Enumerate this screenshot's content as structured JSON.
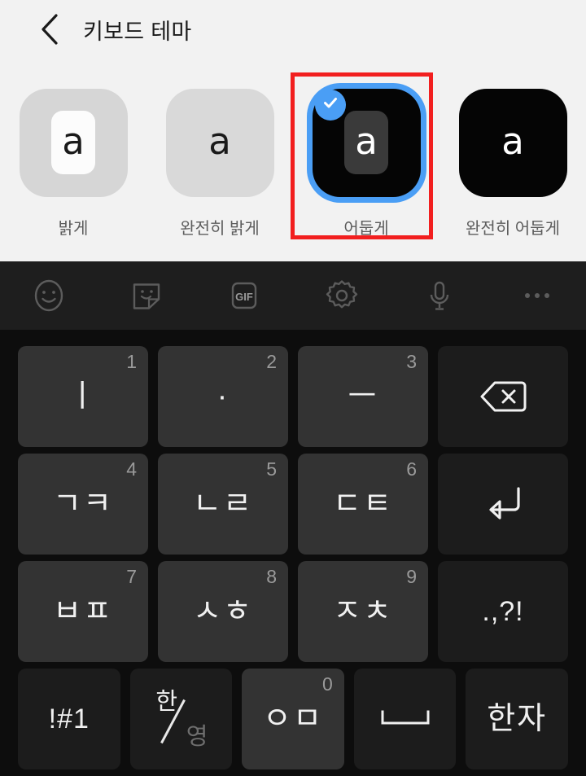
{
  "header": {
    "back_icon": "chevron-left-icon",
    "title": "키보드 테마"
  },
  "themes": {
    "selected_index": 2,
    "items": [
      {
        "label": "밝게",
        "tile_bg": "#d6d6d6",
        "key_bg": "#fcfcfc",
        "glyph": "a",
        "glyph_color": "#1a1a1a",
        "has_inner_key": true,
        "selected": false
      },
      {
        "label": "완전히 밝게",
        "tile_bg": "#d9d9d9",
        "key_bg": "#d9d9d9",
        "glyph": "a",
        "glyph_color": "#1a1a1a",
        "has_inner_key": false,
        "selected": false
      },
      {
        "label": "어둡게",
        "tile_bg": "#050505",
        "key_bg": "#3a3a3a",
        "glyph": "a",
        "glyph_color": "#ffffff",
        "has_inner_key": true,
        "selected": true
      },
      {
        "label": "완전히 어둡게",
        "tile_bg": "#050505",
        "key_bg": "#050505",
        "glyph": "a",
        "glyph_color": "#ffffff",
        "has_inner_key": false,
        "selected": false
      }
    ],
    "selected_ring_color": "#4a9ef5",
    "check_badge_color": "#4a9ef5"
  },
  "annotation": {
    "color": "#f21f1f",
    "target": "어둡게"
  },
  "keyboard": {
    "toolbar": [
      {
        "name": "emoji-icon",
        "label": ""
      },
      {
        "name": "sticker-icon",
        "label": ""
      },
      {
        "name": "gif-icon",
        "label": "GIF"
      },
      {
        "name": "settings-gear-icon",
        "label": ""
      },
      {
        "name": "microphone-icon",
        "label": ""
      },
      {
        "name": "more-options-icon",
        "label": ""
      }
    ],
    "rows": [
      [
        {
          "label": "ㅣ",
          "num": "1",
          "type": "char",
          "icon": ""
        },
        {
          "label": "·",
          "num": "2",
          "type": "char",
          "icon": ""
        },
        {
          "label": "ㅡ",
          "num": "3",
          "type": "char",
          "icon": ""
        },
        {
          "label": "",
          "num": "",
          "type": "func",
          "icon": "backspace-icon"
        }
      ],
      [
        {
          "label": "ㄱㅋ",
          "num": "4",
          "type": "char",
          "icon": ""
        },
        {
          "label": "ㄴㄹ",
          "num": "5",
          "type": "char",
          "icon": ""
        },
        {
          "label": "ㄷㅌ",
          "num": "6",
          "type": "char",
          "icon": ""
        },
        {
          "label": "",
          "num": "",
          "type": "func",
          "icon": "enter-icon"
        }
      ],
      [
        {
          "label": "ㅂㅍ",
          "num": "7",
          "type": "char",
          "icon": ""
        },
        {
          "label": "ㅅㅎ",
          "num": "8",
          "type": "char",
          "icon": ""
        },
        {
          "label": "ㅈㅊ",
          "num": "9",
          "type": "char",
          "icon": ""
        },
        {
          "label": ".,?!",
          "num": "",
          "type": "func",
          "icon": ""
        }
      ]
    ],
    "bottom_row": {
      "symbol_key": "!#1",
      "lang_key": {
        "primary": "한",
        "secondary": "영"
      },
      "om_key": {
        "label": "ㅇㅁ",
        "num": "0"
      },
      "space_key_icon": "space-bar-icon",
      "hanja_key": "한자"
    }
  }
}
